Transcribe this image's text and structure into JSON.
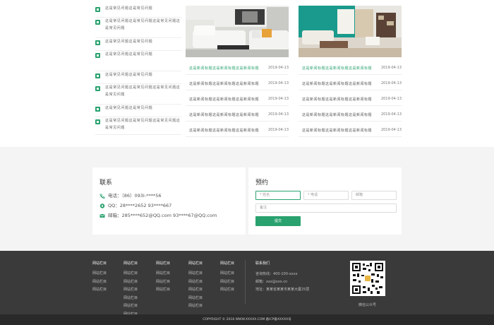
{
  "faq": [
    {
      "text": "这是常见问题这是常见问题"
    },
    {
      "text": "这是常见问题这是常见问题这是常见问题这是常见问题"
    },
    {
      "text": "这是常见问题这是常见问题"
    },
    {
      "text": "这是常见问题这是常见问题"
    },
    {
      "text": "这是常见问题这是常见问题"
    },
    {
      "text": "这是常见问题这是常见问题这是常见问题这是常见问题"
    },
    {
      "text": "这是常见问题这是常见问题"
    },
    {
      "text": "这是常见问题这是常见问题这是常见问题这是常见问题"
    }
  ],
  "news_left": [
    {
      "title": "这是新闻标题这是新闻标题这是新闻标题",
      "date": "2019-04-13"
    },
    {
      "title": "这是新闻标题这是新闻标题这是新闻标题",
      "date": "2019-04-13"
    },
    {
      "title": "这是新闻标题这是新闻标题这是新闻标题",
      "date": "2019-04-13"
    },
    {
      "title": "这是新闻标题这是新闻标题这是新闻标题",
      "date": "2019-04-13"
    },
    {
      "title": "这是新闻标题这是新闻标题这是新闻标题",
      "date": "2019-04-13"
    }
  ],
  "news_right": [
    {
      "title": "这是新闻标题这是新闻标题这是新闻标题",
      "date": "2019-04-13"
    },
    {
      "title": "这是新闻标题这是新闻标题这是新闻标题",
      "date": "2019-04-13"
    },
    {
      "title": "这是新闻标题这是新闻标题这是新闻标题",
      "date": "2019-04-13"
    },
    {
      "title": "这是新闻标题这是新闻标题这是新闻标题",
      "date": "2019-04-13"
    },
    {
      "title": "这是新闻标题这是新闻标题这是新闻标题",
      "date": "2019-04-13"
    }
  ],
  "contact": {
    "title": "联系",
    "phone": "电话：（86）093I-****56",
    "qq": "QQ：28****2652 93****667",
    "email": "邮箱：285****652@QQ.com 93****67@QQ.com"
  },
  "booking": {
    "title": "预约",
    "name_placeholder": "* 姓名",
    "phone_placeholder": "* 电话",
    "email_placeholder": "邮箱",
    "note_placeholder": "备注",
    "submit_label": "提交"
  },
  "footer": {
    "columns": [
      {
        "heading": "网站栏目",
        "links": [
          "网站栏目",
          "网站栏目",
          "网站栏目"
        ]
      },
      {
        "heading": "网站栏目",
        "links": [
          "网站栏目",
          "网站栏目",
          "网站栏目",
          "网站栏目",
          "网站栏目",
          "网站栏目"
        ]
      },
      {
        "heading": "网站栏目",
        "links": [
          "网站栏目",
          "网站栏目",
          "网站栏目"
        ]
      },
      {
        "heading": "网站栏目",
        "links": [
          "网站栏目",
          "网站栏目",
          "网站栏目",
          "网站栏目",
          "网站栏目"
        ]
      },
      {
        "heading": "网站栏目",
        "links": [
          "网站栏目",
          "网站栏目",
          "网站栏目"
        ]
      }
    ],
    "contact_heading": "联系我们",
    "contact_lines": [
      "咨询热线：400-100-xxxx",
      "邮箱：xxx@xxx.cn",
      "地址：某某省某某市某某大厦25层"
    ],
    "qr_caption": "微信公众号",
    "copyright": "COPYRIGHT © 2018 WWW.XXXXX.COM 备ICP备XXXXX号"
  },
  "colors": {
    "accent": "#2aa26f",
    "footer_bg": "#3a3a3a"
  }
}
